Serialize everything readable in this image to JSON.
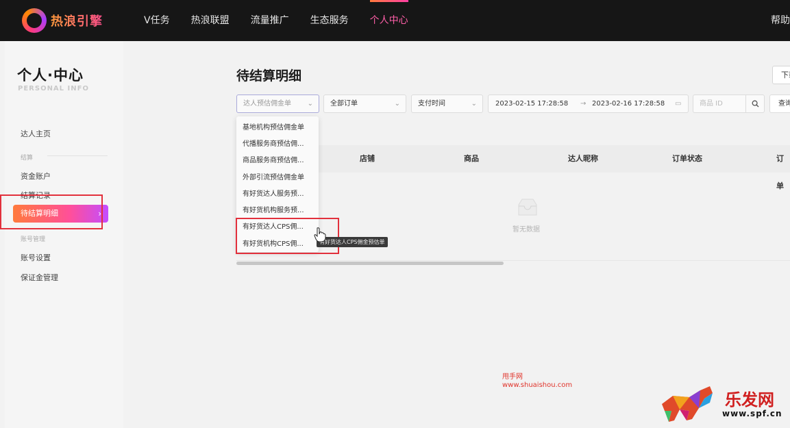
{
  "header": {
    "logo_text": "热浪引擎",
    "nav": [
      "V任务",
      "热浪联盟",
      "流量推广",
      "生态服务",
      "个人中心"
    ],
    "active_nav": "个人中心",
    "help": "帮助"
  },
  "sidebar": {
    "title": "个人·中心",
    "subtitle": "PERSONAL INFO",
    "home": "达人主页",
    "group_settle": "结算",
    "fund_account": "资金账户",
    "settle_record": "结算记录",
    "pending_detail": "待结算明细",
    "group_account": "账号管理",
    "account_settings": "账号设置",
    "deposit_manage": "保证金管理"
  },
  "main": {
    "title": "待结算明细",
    "download": "下载",
    "filters": {
      "type_select": "达人预估佣金单",
      "order_select": "全部订单",
      "time_select": "支付时间",
      "date_start": "2023-02-15 17:28:58",
      "date_sep": "→",
      "date_end": "2023-02-16 17:28:58",
      "product_id_placeholder": "商品 ID",
      "query": "查询"
    },
    "table_headers": [
      "店铺",
      "商品",
      "达人昵称",
      "订单状态",
      "订单"
    ],
    "empty_text": "暂无数据"
  },
  "dropdown": {
    "items": [
      "基地机构预估佣金单",
      "代播服务商预估佣...",
      "商品服务商预估佣...",
      "外部引流预估佣金单",
      "有好货达人服务预...",
      "有好货机构服务预...",
      "有好货达人CPS佣...",
      "有好货机构CPS佣..."
    ],
    "tooltip": "有好货达人CPS佣金预估单"
  },
  "watermarks": {
    "line1": "甩手网",
    "line2": "www.shuaishou.com",
    "brand": "乐发网",
    "brand_url": "www.spf.cn"
  },
  "colors": {
    "accent_gradient_start": "#ff7a3c",
    "accent_gradient_end": "#c34dff",
    "nav_active": "#ff5fa8",
    "highlight_box": "#e2303c"
  }
}
